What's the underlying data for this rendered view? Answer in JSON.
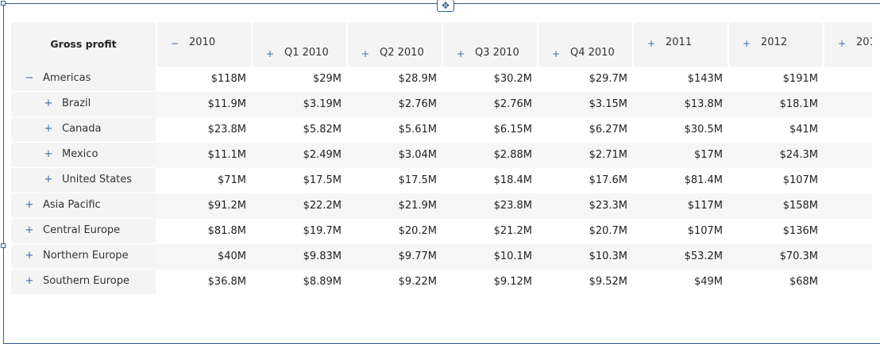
{
  "table": {
    "corner_title": "Gross profit",
    "columns": [
      {
        "label": "2010",
        "toggle": "−"
      },
      {
        "label": "Q1 2010",
        "toggle": "+"
      },
      {
        "label": "Q2 2010",
        "toggle": "+"
      },
      {
        "label": "Q3 2010",
        "toggle": "+"
      },
      {
        "label": "Q4 2010",
        "toggle": "+"
      },
      {
        "label": "2011",
        "toggle": "+"
      },
      {
        "label": "2012",
        "toggle": "+"
      },
      {
        "label": "201",
        "toggle": "+"
      }
    ],
    "rows": [
      {
        "label": "Americas",
        "toggle": "−",
        "values": [
          "$118M",
          "$29M",
          "$28.9M",
          "$30.2M",
          "$29.7M",
          "$143M",
          "$191M"
        ]
      },
      {
        "label": "Brazil",
        "toggle": "+",
        "values": [
          "$11.9M",
          "$3.19M",
          "$2.76M",
          "$2.76M",
          "$3.15M",
          "$13.8M",
          "$18.1M"
        ]
      },
      {
        "label": "Canada",
        "toggle": "+",
        "values": [
          "$23.8M",
          "$5.82M",
          "$5.61M",
          "$6.15M",
          "$6.27M",
          "$30.5M",
          "$41M"
        ]
      },
      {
        "label": "Mexico",
        "toggle": "+",
        "values": [
          "$11.1M",
          "$2.49M",
          "$3.04M",
          "$2.88M",
          "$2.71M",
          "$17M",
          "$24.3M"
        ]
      },
      {
        "label": "United States",
        "toggle": "+",
        "values": [
          "$71M",
          "$17.5M",
          "$17.5M",
          "$18.4M",
          "$17.6M",
          "$81.4M",
          "$107M"
        ]
      },
      {
        "label": "Asia Pacific",
        "toggle": "+",
        "values": [
          "$91.2M",
          "$22.2M",
          "$21.9M",
          "$23.8M",
          "$23.3M",
          "$117M",
          "$158M"
        ]
      },
      {
        "label": "Central Europe",
        "toggle": "+",
        "values": [
          "$81.8M",
          "$19.7M",
          "$20.2M",
          "$21.2M",
          "$20.7M",
          "$107M",
          "$136M"
        ]
      },
      {
        "label": "Northern Europe",
        "toggle": "+",
        "values": [
          "$40M",
          "$9.83M",
          "$9.77M",
          "$10.1M",
          "$10.3M",
          "$53.2M",
          "$70.3M"
        ]
      },
      {
        "label": "Southern Europe",
        "toggle": "+",
        "values": [
          "$36.8M",
          "$8.89M",
          "$9.22M",
          "$9.12M",
          "$9.52M",
          "$49M",
          "$68M"
        ]
      }
    ]
  },
  "icons": {
    "move": "✥"
  }
}
